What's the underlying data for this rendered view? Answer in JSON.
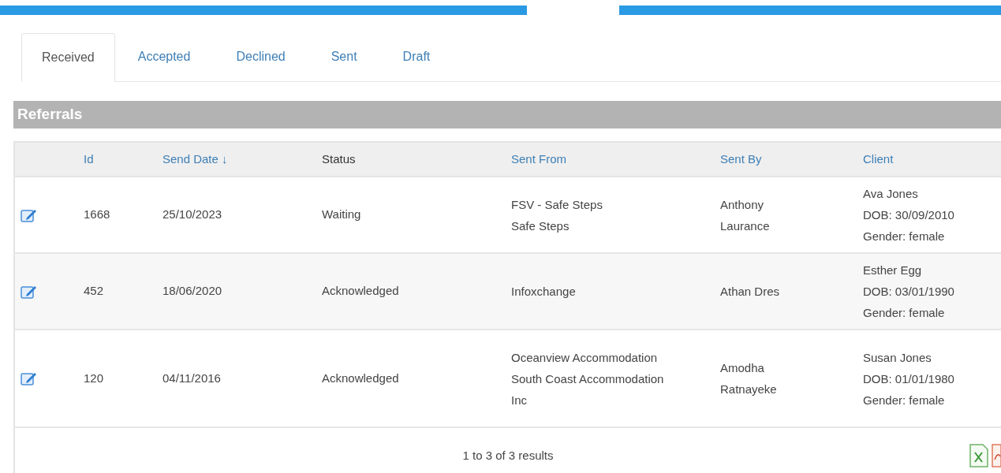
{
  "tabs": [
    {
      "label": "Received",
      "selected": true
    },
    {
      "label": "Accepted",
      "selected": false
    },
    {
      "label": "Declined",
      "selected": false
    },
    {
      "label": "Sent",
      "selected": false
    },
    {
      "label": "Draft",
      "selected": false
    }
  ],
  "panel": {
    "title": "Referrals"
  },
  "table": {
    "columns": [
      {
        "label": "Id",
        "sortable": true
      },
      {
        "label": "Send Date ↓",
        "sortable": true
      },
      {
        "label": "Status",
        "sortable": false
      },
      {
        "label": "Sent From",
        "sortable": true
      },
      {
        "label": "Sent By",
        "sortable": true
      },
      {
        "label": "Client",
        "sortable": true
      }
    ],
    "rows": [
      {
        "id": "1668",
        "send_date": "25/10/2023",
        "status": "Waiting",
        "sent_from": [
          "FSV - Safe Steps",
          "Safe Steps"
        ],
        "sent_by": "Anthony Laurance",
        "client": [
          "Ava Jones",
          "DOB: 30/09/2010",
          "Gender: female"
        ]
      },
      {
        "id": "452",
        "send_date": "18/06/2020",
        "status": "Acknowledged",
        "sent_from": [
          "Infoxchange"
        ],
        "sent_by": "Athan Dres",
        "client": [
          "Esther Egg",
          "DOB: 03/01/1990",
          "Gender: female"
        ]
      },
      {
        "id": "120",
        "send_date": "04/11/2016",
        "status": "Acknowledged",
        "sent_from": [
          "Oceanview Accommodation",
          "South Coast Accommodation Inc"
        ],
        "sent_by": "Amodha Ratnayeke",
        "client": [
          "Susan Jones",
          "DOB: 01/01/1980",
          "Gender: female"
        ]
      }
    ]
  },
  "footer": {
    "summary": "1 to 3 of 3 results"
  }
}
